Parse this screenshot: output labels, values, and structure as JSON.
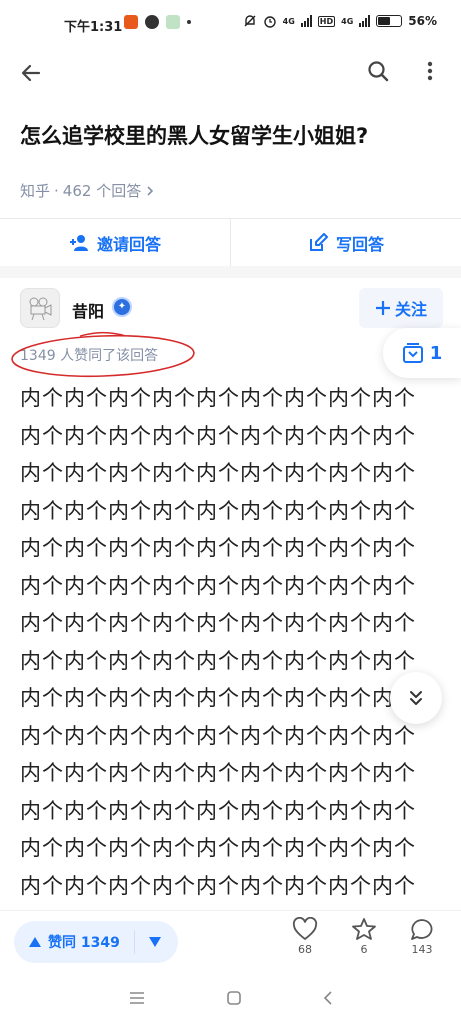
{
  "status_bar": {
    "time": "下午1:31",
    "network_1": "4G",
    "network_2": "HD",
    "network_3": "4G",
    "battery": "56%"
  },
  "topbar": {
    "back_icon": "arrow-left-icon",
    "search_icon": "search-icon",
    "more_icon": "more-vertical-icon"
  },
  "question": {
    "title": "怎么追学校里的黑人女留学生小姐姐?",
    "source": "知乎",
    "answers_count": "462 个回答"
  },
  "actions": {
    "invite_label": "邀请回答",
    "write_label": "写回答"
  },
  "answer": {
    "author": "昔阳",
    "follow_label": "关注",
    "vote_summary": "1349 人赞同了该回答",
    "collect_count": "1",
    "annotation_color": "#d62b2b",
    "content_lines": [
      "内个内个内个内个内个内个内个内个内个",
      "内个内个内个内个内个内个内个内个内个",
      "内个内个内个内个内个内个内个内个内个",
      "内个内个内个内个内个内个内个内个内个",
      "内个内个内个内个内个内个内个内个内个",
      "内个内个内个内个内个内个内个内个内个",
      "内个内个内个内个内个内个内个内个内个",
      "内个内个内个内个内个内个内个内个内个",
      "内个内个内个内个内个内个内个内个内个",
      "内个内个内个内个内个内个内个内个内个",
      "内个内个内个内个内个内个内个内个内个",
      "内个内个内个内个内个内个内个内个内个",
      "内个内个内个内个内个内个内个内个内个",
      "内个内个内个内个内个内个内个内个内个"
    ]
  },
  "toolbar": {
    "upvote_label": "赞同 1349",
    "like_count": "68",
    "star_count": "6",
    "comment_count": "143"
  },
  "colors": {
    "accent": "#1772f6",
    "meta": "#8590a6"
  }
}
